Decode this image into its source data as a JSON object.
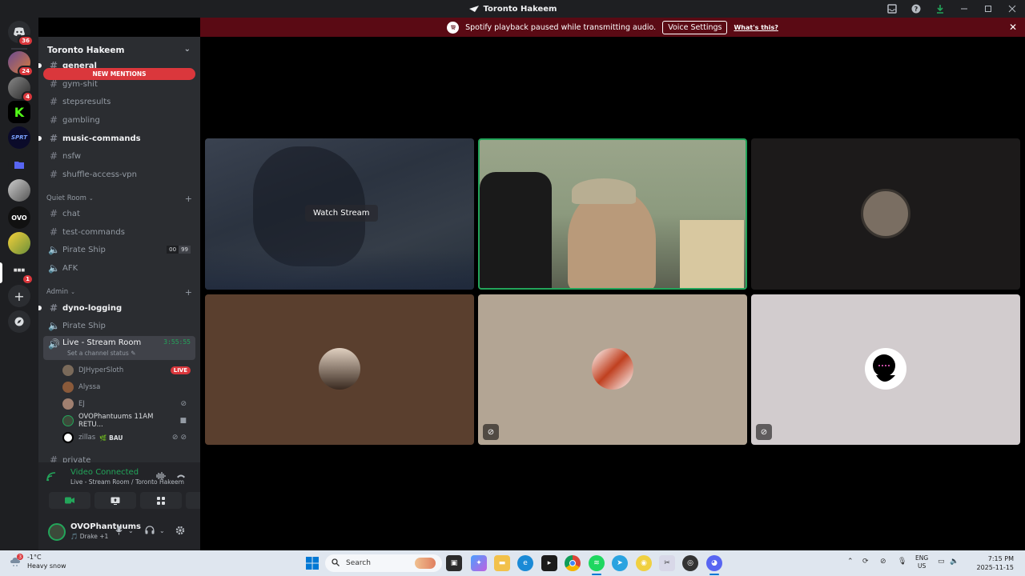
{
  "window": {
    "title": "Toronto Hakeem"
  },
  "notice": {
    "text": "Spotify playback paused while transmitting audio.",
    "button": "Voice Settings",
    "link": "What's this?"
  },
  "rail": {
    "dm_badge": "36",
    "server2_badge": "24",
    "server3_badge": "4",
    "server_active_badge": "1",
    "ovo_label": "OVO"
  },
  "server": {
    "name": "Toronto Hakeem"
  },
  "mentions_label": "NEW MENTIONS",
  "channels_top": [
    {
      "name": "general"
    },
    {
      "name": "gym-shit"
    },
    {
      "name": "stepsresults"
    },
    {
      "name": "gambling"
    },
    {
      "name": "music-commands"
    },
    {
      "name": "nsfw"
    },
    {
      "name": "shuffle-access-vpn"
    }
  ],
  "cat_quiet": "Quiet Room",
  "channels_quiet": [
    {
      "name": "chat"
    },
    {
      "name": "test-commands"
    },
    {
      "name": "Pirate Ship",
      "chip_a": "00",
      "chip_b": "99"
    },
    {
      "name": "AFK"
    }
  ],
  "cat_admin": "Admin",
  "channels_admin": [
    {
      "name": "dyno-logging"
    },
    {
      "name": "Pirate Ship"
    }
  ],
  "voice_channel": {
    "name": "Live - Stream Room",
    "time": "3:55:55",
    "status": "Set a channel status"
  },
  "voice_users": [
    {
      "name": "DJHyperSloth",
      "badge": "LIVE"
    },
    {
      "name": "Alyssa"
    },
    {
      "name": "EJ"
    },
    {
      "name": "OVOPhantuums 11AM RETU..."
    },
    {
      "name": "zillas",
      "tag": "BAU"
    }
  ],
  "next_channel": "private",
  "voice_panel": {
    "title": "Video Connected",
    "sub": "Live - Stream Room / Toronto Hakeem"
  },
  "user": {
    "name": "OVOPhantuums",
    "status": "Drake +1"
  },
  "stage": {
    "watch_label": "Watch Stream"
  },
  "taskbar": {
    "temp": "-1°C",
    "weather": "Heavy snow",
    "weather_badge": "3",
    "search": "Search",
    "lang_top": "ENG",
    "lang_bottom": "US",
    "time": "7:15 PM",
    "date": "2025-11-15"
  },
  "colors": {
    "accent_green": "#23a55a",
    "danger": "#da373c",
    "notice_bg": "#5a0a14"
  }
}
